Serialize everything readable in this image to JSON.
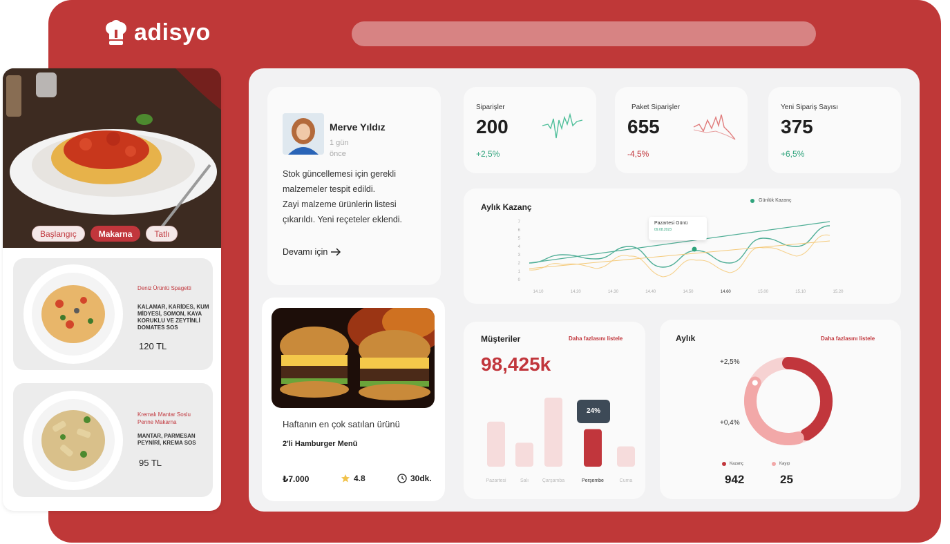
{
  "brand": {
    "name": "adisyo"
  },
  "colors": {
    "brand": "#bf3838",
    "accent": "#c1363c",
    "positive": "#2fa37c",
    "panel": "#f2f2f3"
  },
  "menu": {
    "chips": [
      "Başlangıç",
      "Makarna",
      "Tatlı"
    ],
    "active_chip": "Makarna",
    "dishes": [
      {
        "name": "Deniz Ürünlü Spagetti",
        "desc": "KALAMAR, KARİDES, KUM MİDYESİ, SOMON, KAYA KORUKLU VE ZEYTİNLİ DOMATES SOS",
        "price": "120 TL"
      },
      {
        "name": "Kremalı Mantar Soslu Penne Makarna",
        "desc": "MANTAR, PARMESAN PEYNİRİ, KREMA SOS",
        "price": "95 TL"
      }
    ]
  },
  "note": {
    "author": "Merve Yıldız",
    "time": "1 gün önce",
    "lines": [
      "Stok güncellemesi için gerekli",
      "malzemeler tespit edildi.",
      "Zayi malzeme ürünlerin listesi",
      "çıkarıldı. Yeni reçeteler eklendi."
    ],
    "more": "Devamı için"
  },
  "bestseller": {
    "title": "Haftanın en çok satılan ürünü",
    "product": "2'li Hamburger Menü",
    "price": "₺7.000",
    "rating": "4.8",
    "time": "30dk."
  },
  "stats": [
    {
      "label": "Siparişler",
      "value": "200",
      "delta": "+2,5%"
    },
    {
      "label": "Paket Siparişler",
      "value": "655",
      "delta": "-4,5%"
    },
    {
      "label": "Yeni Sipariş Sayısı",
      "value": "375",
      "delta": "+6,5%"
    }
  ],
  "monthly_earnings": {
    "title": "Aylık Kazanç",
    "legend": "Günlük Kazanç",
    "tooltip_title": "Pazartesi Günü",
    "tooltip_sub": "09.08.2023",
    "y_ticks": [
      "7",
      "6",
      "5",
      "4",
      "3",
      "2",
      "1",
      "0"
    ],
    "x_ticks": [
      "14.10",
      "14.20",
      "14.30",
      "14.40",
      "14.50",
      "14.60",
      "15.00",
      "15.10",
      "15.20"
    ]
  },
  "customers": {
    "title": "Müşteriler",
    "link": "Daha fazlasını listele",
    "value": "98,425k",
    "badge": "24%",
    "days": [
      "Pazartesi",
      "Salı",
      "Çarşamba",
      "Perşembe",
      "Cuma"
    ]
  },
  "monthly_ring": {
    "title": "Aylık",
    "link": "Daha fazlasını listele",
    "pct_top": "+2,5%",
    "pct_mid": "+0,4%",
    "legend": [
      {
        "label": "Kazanç",
        "value": "942",
        "color": "#c1363c"
      },
      {
        "label": "Kayıp",
        "value": "25",
        "color": "#f2a8a8"
      }
    ]
  },
  "chart_data": [
    {
      "type": "line",
      "title": "Aylık Kazanç",
      "x": [
        "14.10",
        "14.20",
        "14.30",
        "14.40",
        "14.50",
        "14.60",
        "15.00",
        "15.10",
        "15.20"
      ],
      "ylim": [
        0,
        7
      ],
      "legend": "top-right",
      "series": [
        {
          "name": "Günlük Kazanç",
          "values": [
            2,
            3,
            2.5,
            4,
            1.5,
            3.5,
            2,
            5,
            4,
            6.5
          ]
        }
      ]
    },
    {
      "type": "bar",
      "title": "Müşteriler",
      "categories": [
        "Pazartesi",
        "Salı",
        "Çarşamba",
        "Perşembe",
        "Cuma"
      ],
      "values": [
        60,
        32,
        92,
        50,
        27
      ],
      "highlight": "Perşembe",
      "highlight_label": "24%"
    },
    {
      "type": "pie",
      "title": "Aylık",
      "categories": [
        "Kazanç",
        "Kayıp"
      ],
      "values": [
        942,
        25
      ]
    }
  ]
}
